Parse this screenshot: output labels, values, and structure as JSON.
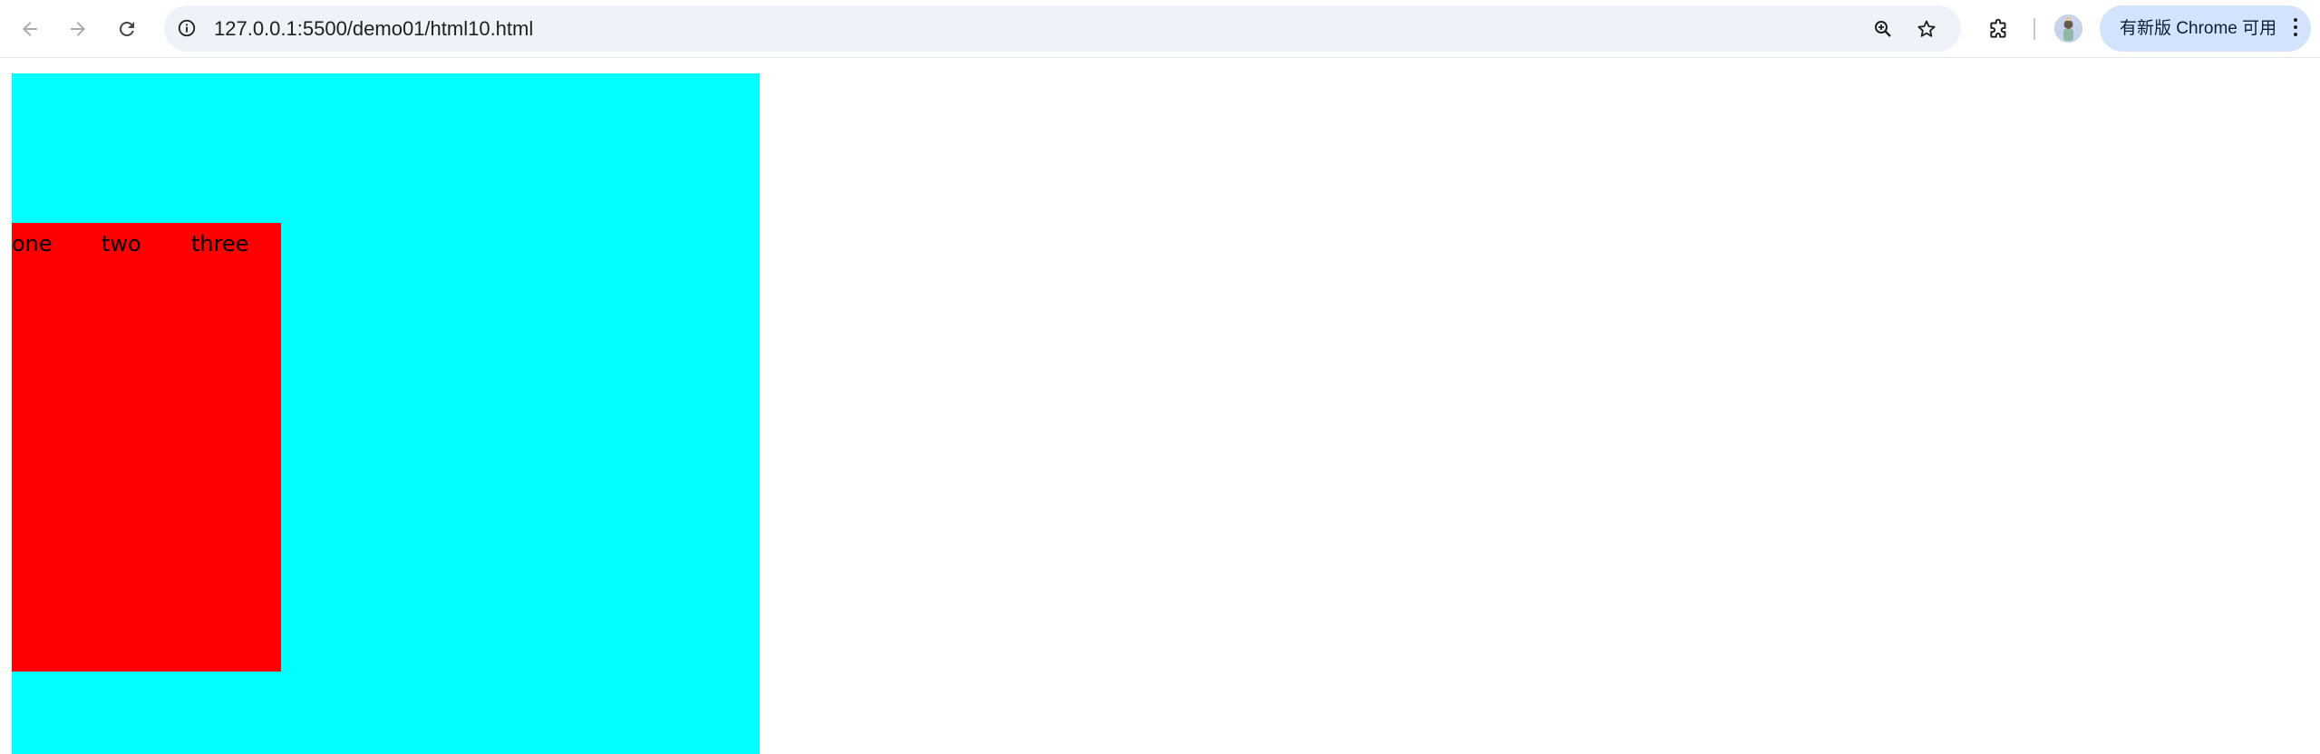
{
  "browser": {
    "url": "127.0.0.1:5500/demo01/html10.html",
    "update_button_label": "有新版 Chrome 可用",
    "icons": {
      "back": "back-arrow-icon",
      "forward": "forward-arrow-icon",
      "reload": "reload-icon",
      "site_info": "info-icon",
      "zoom": "zoom-icon",
      "bookmark": "star-icon",
      "extensions": "puzzle-icon",
      "menu": "kebab-menu-icon"
    }
  },
  "page": {
    "outer_color": "#00ffff",
    "inner_color": "#ff0000",
    "items": [
      "one",
      "two",
      "three"
    ]
  }
}
